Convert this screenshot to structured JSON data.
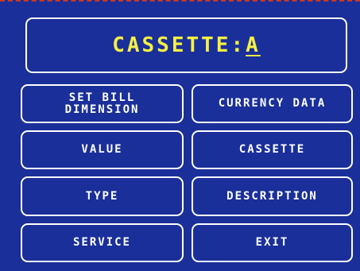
{
  "title": {
    "label": "CASSETTE:",
    "value": "A"
  },
  "buttons": {
    "set_bill_dimension": "SET BILL\nDIMENSION",
    "currency_data": "CURRENCY DATA",
    "value": "VALUE",
    "cassette": "CASSETTE",
    "type": "TYPE",
    "description": "DESCRIPTION",
    "service": "SERVICE",
    "exit": "EXIT"
  },
  "colors": {
    "background": "#1a2f99",
    "title_text": "#f5f043",
    "button_text": "#ffffff",
    "border": "#ffffff"
  }
}
